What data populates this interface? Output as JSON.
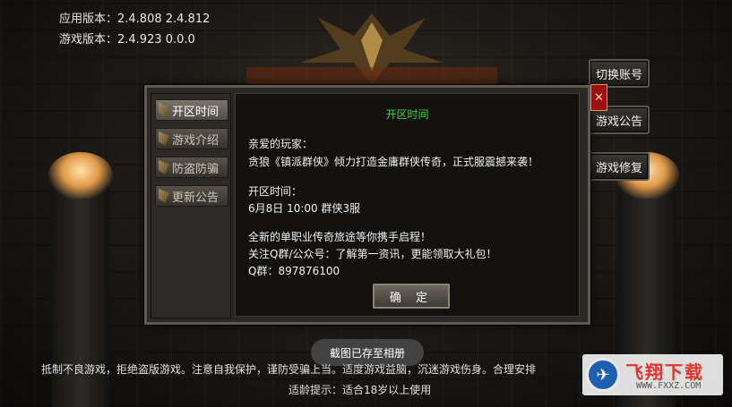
{
  "versions": {
    "app": "应用版本：2.4.808  2.4.812",
    "game": "游戏版本：2.4.923  0.0.0"
  },
  "side_buttons": [
    "切换账号",
    "游戏公告",
    "游戏修复"
  ],
  "dialog": {
    "tabs": [
      "开区时间",
      "游戏介绍",
      "防盗防骗",
      "更新公告"
    ],
    "active_tab": 0,
    "title": "开区时间",
    "lines": [
      "亲爱的玩家：",
      "贪狼《镇派群侠》倾力打造金庸群侠传奇，正式服震撼来袭！",
      "开区时间：",
      "6月8日 10:00   群侠3服",
      "全新的单职业传奇旅途等你携手启程！",
      "关注Q群/公众号：了解第一资讯，更能领取大礼包！",
      "Q群：897876100"
    ],
    "confirm": "确 定",
    "close": "✕"
  },
  "toast": "截图已存至相册",
  "footer": {
    "notice": "抵制不良游戏，拒绝盗版游戏。注意自我保护，谨防受骗上当。适度游戏益脑，沉迷游戏伤身。合理安排",
    "age": "适龄提示：适合18岁以上使用"
  },
  "watermark": {
    "title": "飞翔下载",
    "url": "WWW.FXXZ.COM",
    "icon": "bird-logo-icon"
  },
  "colors": {
    "title_green": "#46d046",
    "close_red": "#9b1010"
  }
}
